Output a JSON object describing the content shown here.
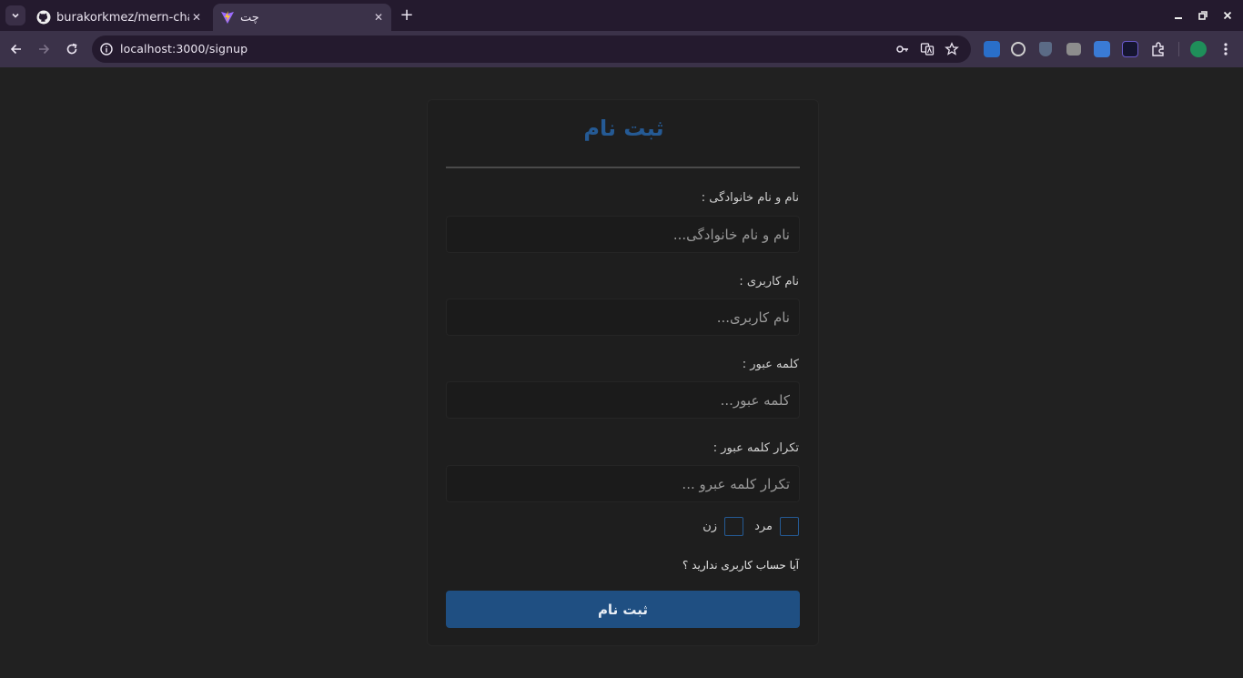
{
  "browser": {
    "tabs": [
      {
        "title": "burakorkmez/mern-chat",
        "favicon": "github-icon"
      },
      {
        "title": "چت",
        "favicon": "vite-icon",
        "active": true
      }
    ],
    "url": "localhost:3000/signup"
  },
  "form": {
    "title": "ثبت نام",
    "fullname": {
      "label": "نام و نام خانوادگی :",
      "placeholder": "نام و نام خانوادگی..."
    },
    "username": {
      "label": "نام کاربری :",
      "placeholder": "نام کاربری..."
    },
    "password": {
      "label": "کلمه عبور :",
      "placeholder": "کلمه عبور..."
    },
    "confirm": {
      "label": "تکرار کلمه عبور :",
      "placeholder": "تکرار کلمه عبرو ..."
    },
    "gender": {
      "male": "مرد",
      "female": "زن"
    },
    "account_question": "آیا حساب کاربری ندارید ؟",
    "submit_label": "ثبت نام"
  },
  "colors": {
    "accent": "#255a94",
    "button": "#1f4f82",
    "background": "#212121"
  }
}
